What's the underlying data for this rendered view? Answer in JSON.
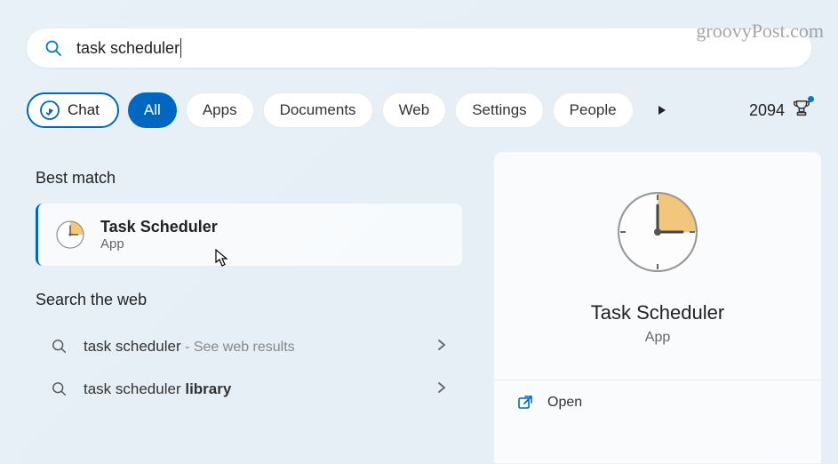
{
  "watermark": "groovyPost.com",
  "search": {
    "value": "task scheduler"
  },
  "filters": {
    "chat": "Chat",
    "all": "All",
    "apps": "Apps",
    "documents": "Documents",
    "web": "Web",
    "settings": "Settings",
    "people": "People"
  },
  "points": "2094",
  "left": {
    "best_match": "Best match",
    "result": {
      "title": "Task Scheduler",
      "sub": "App"
    },
    "search_web": "Search the web",
    "web1": {
      "text": "task scheduler",
      "hint": " - See web results"
    },
    "web2": {
      "prefix": "task scheduler ",
      "bold": "library"
    }
  },
  "right": {
    "title": "Task Scheduler",
    "sub": "App",
    "open": "Open"
  }
}
